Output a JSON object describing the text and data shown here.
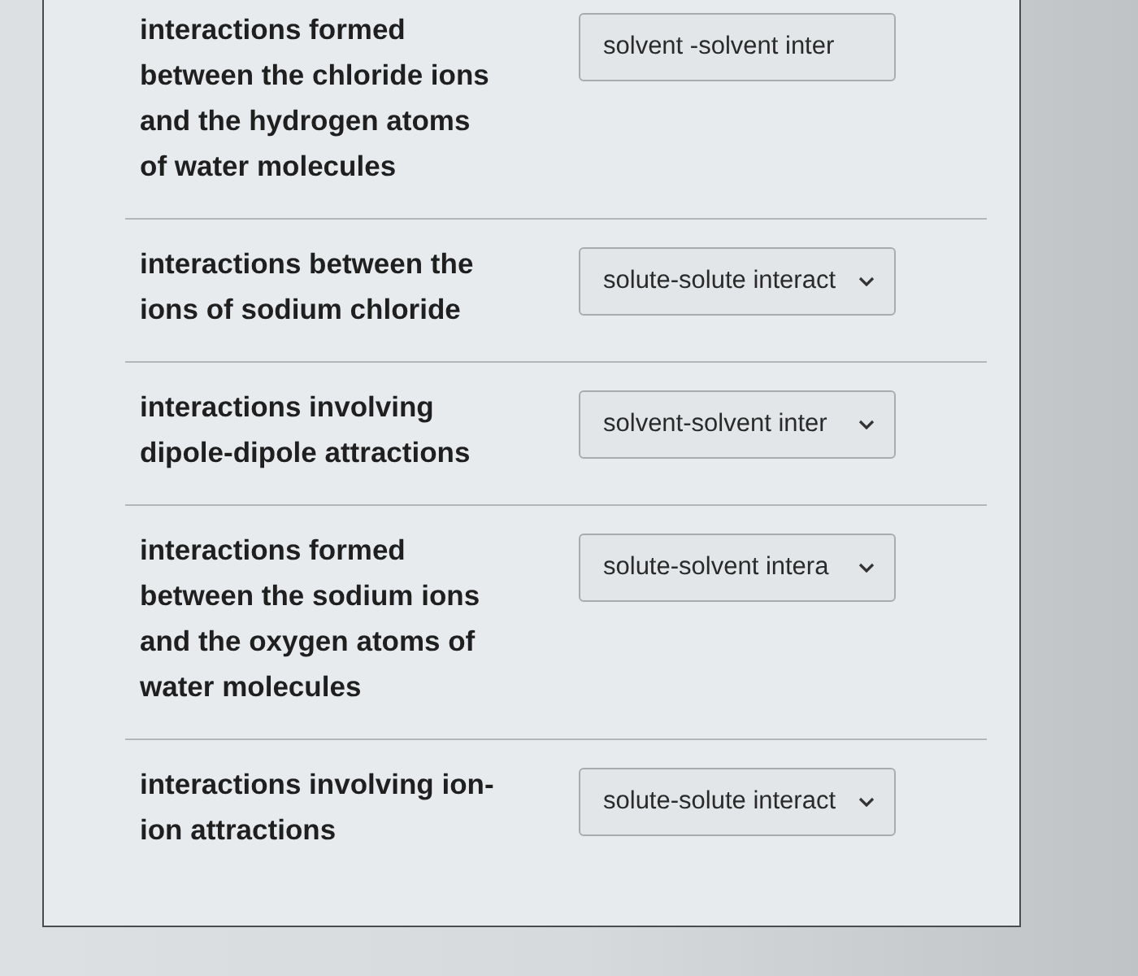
{
  "questions": [
    {
      "prompt": "interactions formed\nbetween the chloride ions\nand the hydrogen atoms\nof water molecules",
      "answer": "solvent -solvent inter",
      "chevron": false
    },
    {
      "prompt": "interactions between the\nions of sodium chloride",
      "answer": "solute-solute interact",
      "chevron": true
    },
    {
      "prompt": "interactions involving\ndipole-dipole attractions",
      "answer": "solvent-solvent inter",
      "chevron": true
    },
    {
      "prompt": "interactions formed\nbetween the sodium ions\nand the oxygen atoms of\nwater molecules",
      "answer": "solute-solvent intera",
      "chevron": true
    },
    {
      "prompt": "interactions involving ion-\nion attractions",
      "answer": "solute-solute interact",
      "chevron": true
    }
  ]
}
